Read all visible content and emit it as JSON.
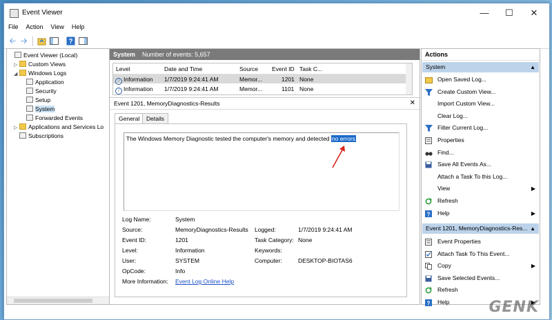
{
  "window": {
    "title": "Event Viewer"
  },
  "menu": [
    "File",
    "Action",
    "View",
    "Help"
  ],
  "tree": {
    "root": "Event Viewer (Local)",
    "custom_views": "Custom Views",
    "windows_logs": "Windows Logs",
    "logs": [
      "Application",
      "Security",
      "Setup",
      "System",
      "Forwarded Events"
    ],
    "apps_services": "Applications and Services Lo",
    "subscriptions": "Subscriptions"
  },
  "center": {
    "log_name": "System",
    "event_count_label": "Number of events: 5,657",
    "columns": [
      "Level",
      "Date and Time",
      "Source",
      "Event ID",
      "Task C..."
    ],
    "rows": [
      {
        "level": "Information",
        "datetime": "1/7/2019 9:24:41 AM",
        "source": "Memor...",
        "event_id": "1201",
        "task": "None"
      },
      {
        "level": "Information",
        "datetime": "1/7/2019 9:24:41 AM",
        "source": "Memor...",
        "event_id": "1101",
        "task": "None"
      }
    ],
    "detail_title": "Event 1201, MemoryDiagnostics-Results",
    "tabs": [
      "General",
      "Details"
    ],
    "message_prefix": "The Windows Memory Diagnostic tested the computer's memory and detected ",
    "message_highlight": "no errors",
    "properties": {
      "log_name_label": "Log Name:",
      "log_name_value": "System",
      "source_label": "Source:",
      "source_value": "MemoryDiagnostics-Results",
      "logged_label": "Logged:",
      "logged_value": "1/7/2019 9:24:41 AM",
      "event_id_label": "Event ID:",
      "event_id_value": "1201",
      "task_category_label": "Task Category:",
      "task_category_value": "None",
      "level_label": "Level:",
      "level_value": "Information",
      "keywords_label": "Keywords:",
      "keywords_value": "",
      "user_label": "User:",
      "user_value": "SYSTEM",
      "computer_label": "Computer:",
      "computer_value": "DESKTOP-BIOTAS6",
      "opcode_label": "OpCode:",
      "opcode_value": "Info",
      "more_info_label": "More Information:",
      "more_info_link": "Event Log Online Help"
    }
  },
  "actions": {
    "title": "Actions",
    "section1": "System",
    "items1": [
      {
        "label": "Open Saved Log...",
        "icon": "folder-open-icon"
      },
      {
        "label": "Create Custom View...",
        "icon": "filter-icon"
      },
      {
        "label": "Import Custom View...",
        "icon": ""
      },
      {
        "label": "Clear Log...",
        "icon": ""
      },
      {
        "label": "Filter Current Log...",
        "icon": "filter-icon"
      },
      {
        "label": "Properties",
        "icon": "properties-icon"
      },
      {
        "label": "Find...",
        "icon": "binoculars-icon"
      },
      {
        "label": "Save All Events As...",
        "icon": "save-icon"
      },
      {
        "label": "Attach a Task To this Log...",
        "icon": ""
      },
      {
        "label": "View",
        "icon": "",
        "submenu": "▶"
      },
      {
        "label": "Refresh",
        "icon": "refresh-icon"
      },
      {
        "label": "Help",
        "icon": "help-icon",
        "submenu": "▶"
      }
    ],
    "section2": "Event 1201, MemoryDiagnostics-Res...",
    "items2": [
      {
        "label": "Event Properties",
        "icon": "properties-icon"
      },
      {
        "label": "Attach Task To This Event...",
        "icon": "task-icon"
      },
      {
        "label": "Copy",
        "icon": "copy-icon",
        "submenu": "▶"
      },
      {
        "label": "Save Selected Events...",
        "icon": "save-icon"
      },
      {
        "label": "Refresh",
        "icon": "refresh-icon"
      },
      {
        "label": "Help",
        "icon": "help-icon",
        "submenu": "▶"
      }
    ]
  },
  "watermark": "GENK",
  "colors": {
    "selection": "#1b6ac9",
    "section_bg": "#bcd3ea",
    "header_bg": "#7a7a7a",
    "annotation_arrow": "#d9261c"
  }
}
